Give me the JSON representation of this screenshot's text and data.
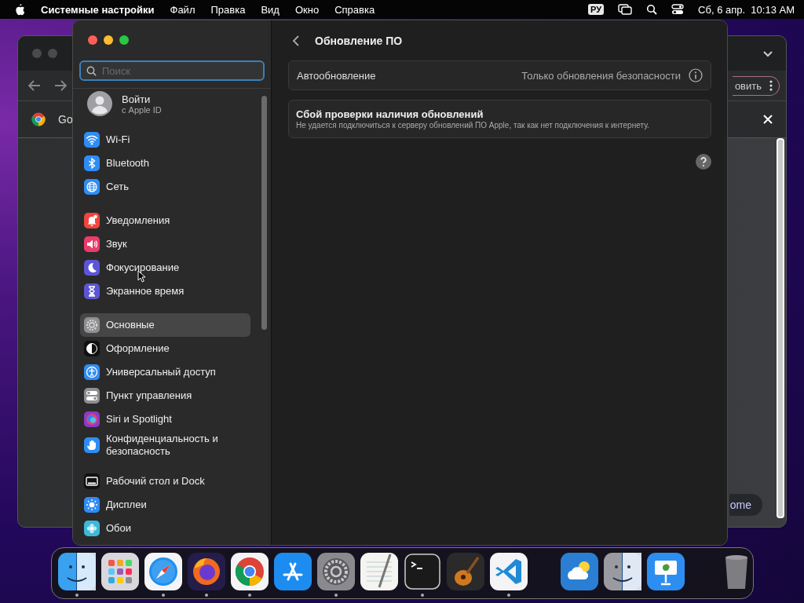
{
  "menubar": {
    "app_name": "Системные настройки",
    "menus": [
      "Файл",
      "Правка",
      "Вид",
      "Окно",
      "Справка"
    ],
    "input_source": "РУ",
    "date_time": "Сб, 6 апр.  10:13 AM"
  },
  "background_window": {
    "tab_title": "Go",
    "toolbar_button": "овить",
    "bottom_button": "ome"
  },
  "settings": {
    "search": {
      "placeholder": "Поиск"
    },
    "account": {
      "title": "Войти",
      "subtitle": "с Apple ID"
    },
    "groups": [
      [
        {
          "label": "Wi-Fi",
          "kind": "wifi",
          "color": "#2f8cf5",
          "selected": false
        },
        {
          "label": "Bluetooth",
          "kind": "bluetooth",
          "color": "#2f8cf5",
          "selected": false
        },
        {
          "label": "Сеть",
          "kind": "globe",
          "color": "#2f8cf5",
          "selected": false
        }
      ],
      [
        {
          "label": "Уведомления",
          "kind": "bell",
          "color": "#f0453e",
          "selected": false
        },
        {
          "label": "Звук",
          "kind": "speaker",
          "color": "#ec3b68",
          "selected": false
        },
        {
          "label": "Фокусирование",
          "kind": "moon",
          "color": "#5c55d6",
          "selected": false
        },
        {
          "label": "Экранное время",
          "kind": "hourglass",
          "color": "#5c55d6",
          "selected": false
        }
      ],
      [
        {
          "label": "Основные",
          "kind": "gear",
          "color": "#8e8e93",
          "selected": true
        },
        {
          "label": "Оформление",
          "kind": "contrast",
          "color": "#111111",
          "selected": false
        },
        {
          "label": "Универсальный доступ",
          "kind": "accessibility",
          "color": "#2f8cf5",
          "selected": false
        },
        {
          "label": "Пункт управления",
          "kind": "toggles",
          "color": "#8e8e93",
          "selected": false
        },
        {
          "label": "Siri и Spotlight",
          "kind": "orb",
          "color": "#8a3bc6",
          "selected": false
        },
        {
          "label": "Конфиденциальность и безопасность",
          "kind": "hand",
          "color": "#2f8cf5",
          "selected": false
        }
      ],
      [
        {
          "label": "Рабочий стол и Dock",
          "kind": "dock",
          "color": "#111111",
          "selected": false
        },
        {
          "label": "Дисплеи",
          "kind": "sun",
          "color": "#2f8cf5",
          "selected": false
        },
        {
          "label": "Обои",
          "kind": "flower",
          "color": "#3eb8d8",
          "selected": false
        }
      ]
    ],
    "page": {
      "title": "Обновление ПО",
      "rows": [
        {
          "kind": "setting",
          "label": "Автообновление",
          "value": "Только обновления безопасности"
        },
        {
          "kind": "alert",
          "title": "Сбой проверки наличия обновлений",
          "message": "Не удается подключиться к серверу обновлений ПО Apple, так как нет подключения к интернету."
        }
      ]
    }
  },
  "dock": {
    "sections": [
      [
        {
          "kind": "finder",
          "running": true
        },
        {
          "kind": "launchpad",
          "running": false
        },
        {
          "kind": "safari",
          "running": true
        },
        {
          "kind": "firefox",
          "running": true
        },
        {
          "kind": "chrome",
          "running": true
        },
        {
          "kind": "appstore",
          "running": false
        },
        {
          "kind": "settings",
          "running": true
        },
        {
          "kind": "textedit",
          "running": false
        },
        {
          "kind": "terminal",
          "running": true
        },
        {
          "kind": "garageband",
          "running": false
        },
        {
          "kind": "vscode",
          "running": true
        }
      ],
      [
        {
          "kind": "weather",
          "running": false
        },
        {
          "kind": "migration",
          "running": false
        },
        {
          "kind": "keynote",
          "running": false
        }
      ],
      [
        {
          "kind": "trash",
          "running": false
        }
      ]
    ]
  }
}
